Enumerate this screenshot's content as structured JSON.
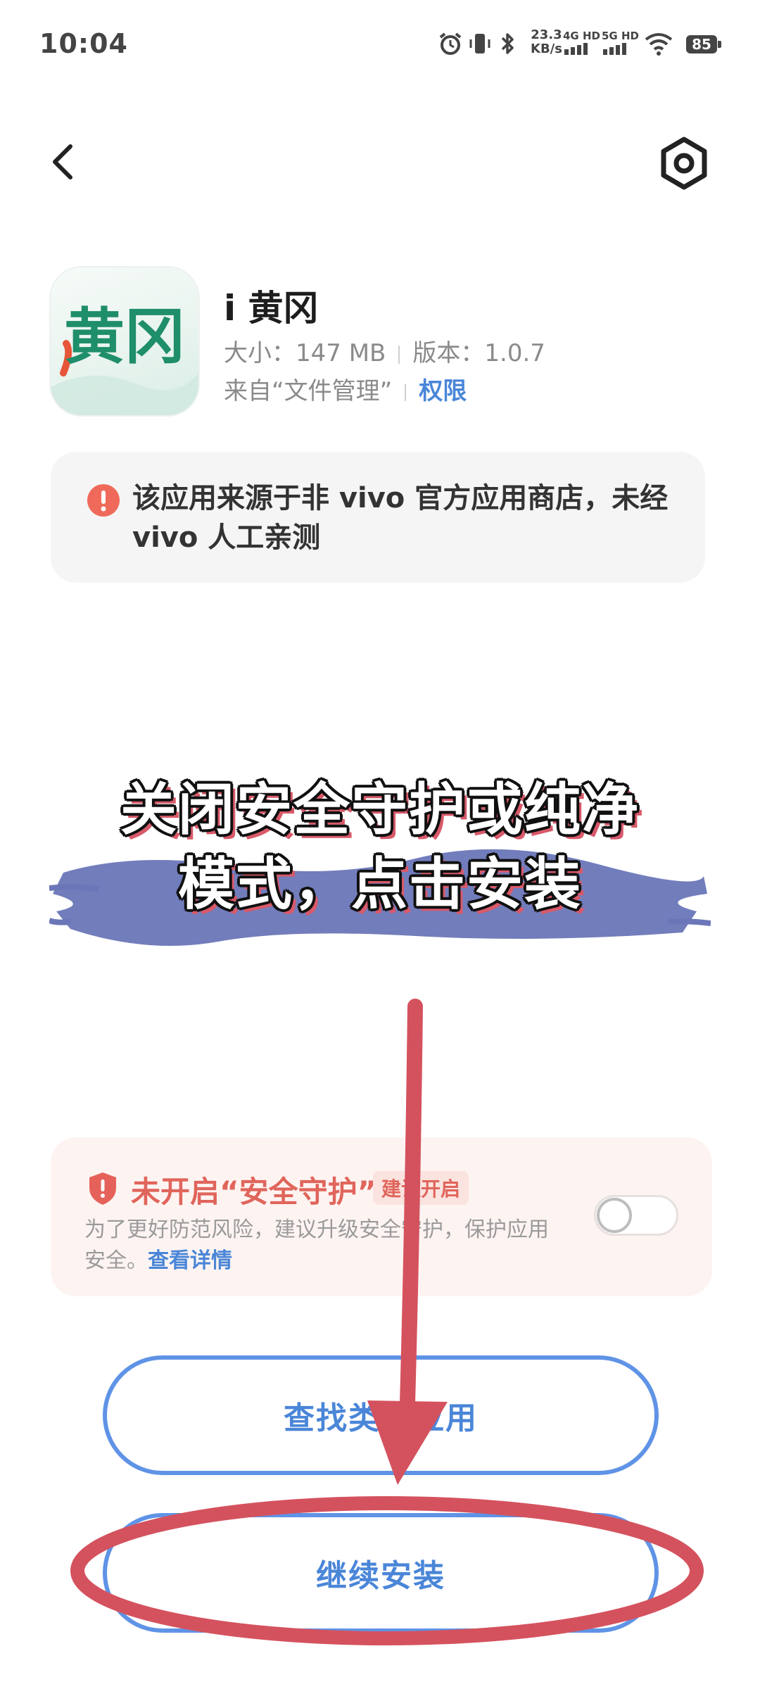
{
  "status_bar": {
    "time": "10:04",
    "speed_value": "23.3",
    "speed_unit": "KB/s",
    "net1": "4G HD",
    "net2": "5G HD",
    "battery": "85"
  },
  "app": {
    "name": "i 黄冈",
    "size_label": "大小：147 MB",
    "version_label": "版本：1.0.7",
    "source_label": "来自“文件管理”",
    "permissions_link": "权限",
    "icon_text": "黄冈"
  },
  "warning": {
    "text": "该应用来源于非 vivo 官方应用商店，未经 vivo 人工亲测"
  },
  "caption": {
    "line1": "关闭安全守护或纯净",
    "line2": "模式，点击安装"
  },
  "security": {
    "title": "未开启“安全守护”",
    "badge": "建议开启",
    "description": "为了更好防范风险，建议升级安全守护，保护应用安全。",
    "details_link": "查看详情",
    "toggle_on": false
  },
  "buttons": {
    "find_similar": "查找类似应用",
    "continue_install": "继续安装"
  },
  "colors": {
    "accent_blue": "#4a86d8",
    "warning_red": "#e0655b",
    "annotation_red": "#d4525e",
    "brush_blue": "#6a76b8"
  }
}
